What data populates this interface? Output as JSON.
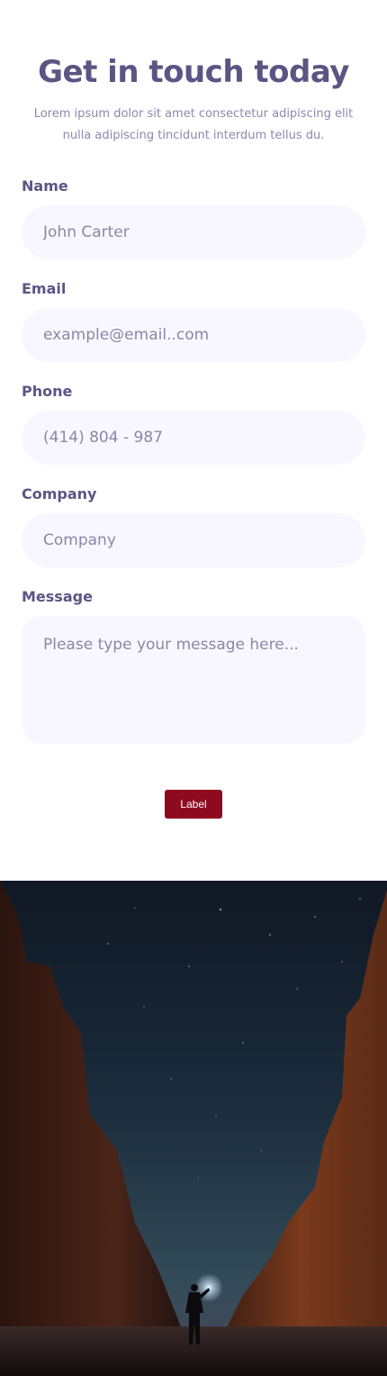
{
  "header": {
    "title": "Get in touch today",
    "subtitle": "Lorem ipsum dolor sit amet consectetur adipiscing elit nulla adipiscing tincidunt interdum tellus du."
  },
  "form": {
    "name": {
      "label": "Name",
      "placeholder": "John Carter",
      "value": ""
    },
    "email": {
      "label": "Email",
      "placeholder": "example@email..com",
      "value": ""
    },
    "phone": {
      "label": "Phone",
      "placeholder": "(414) 804 - 987",
      "value": ""
    },
    "company": {
      "label": "Company",
      "placeholder": "Company",
      "value": ""
    },
    "message": {
      "label": "Message",
      "placeholder": "Please type your message here...",
      "value": ""
    },
    "submit_label": "Label"
  },
  "colors": {
    "heading": "#5b5584",
    "field_background": "#f8f7ff",
    "button": "#8e0b1f"
  }
}
